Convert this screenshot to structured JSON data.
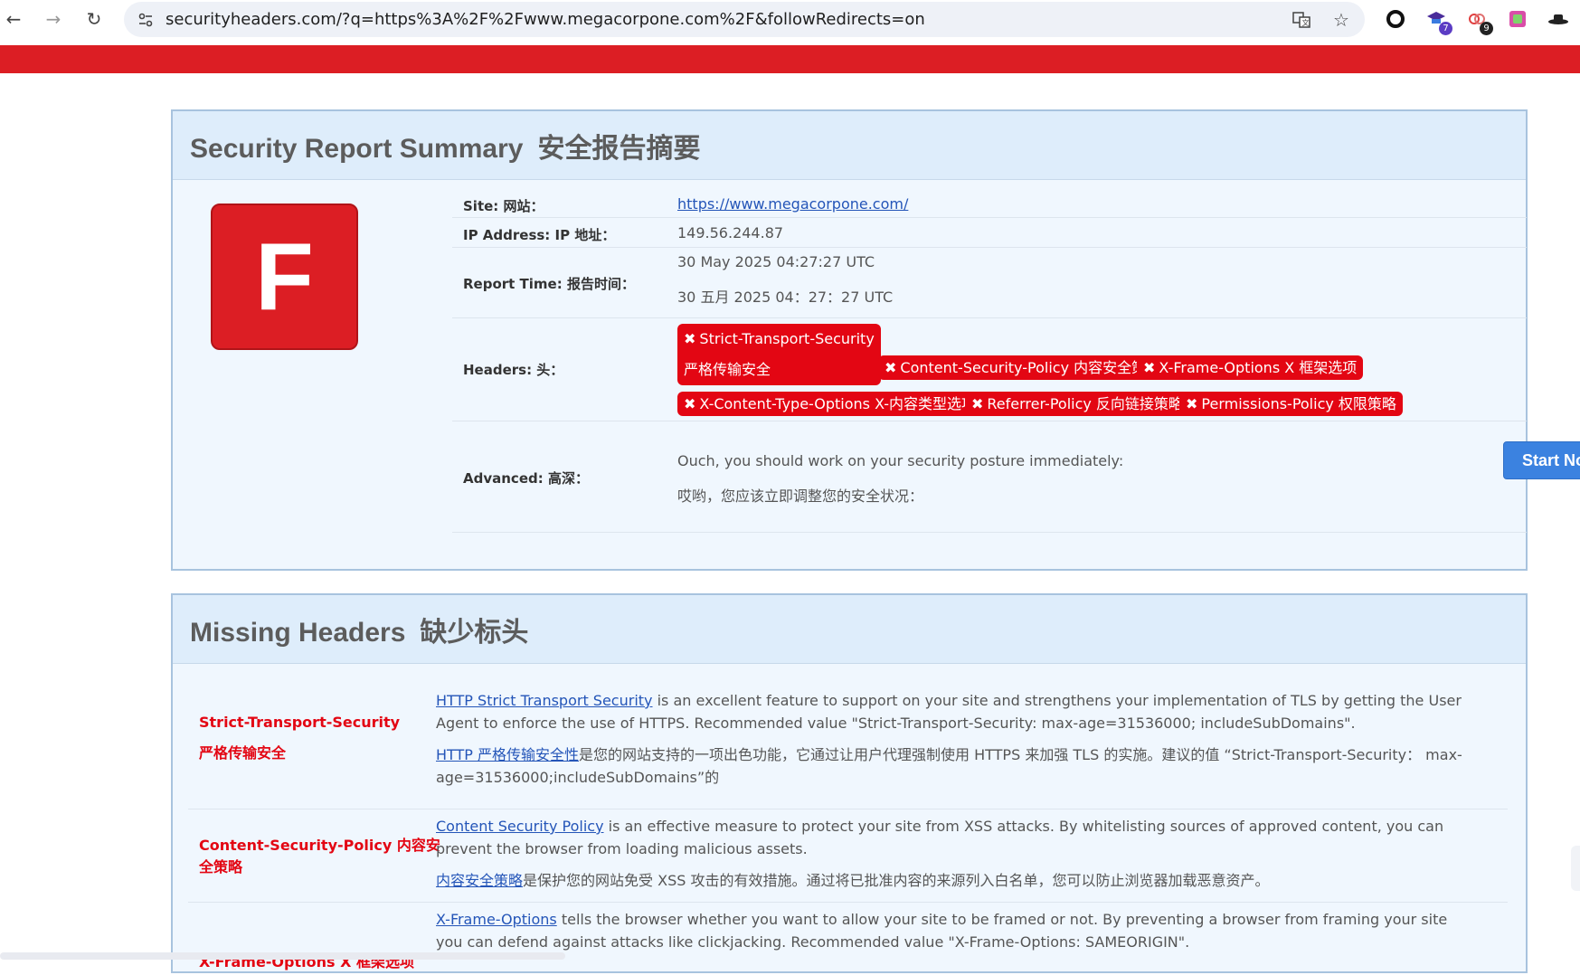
{
  "browser": {
    "url": "securityheaders.com/?q=https%3A%2F%2Fwww.megacorpone.com%2F&followRedirects=on",
    "ext_badges": [
      "7",
      "9"
    ]
  },
  "summary": {
    "title": "Security Report Summary",
    "title_zh": "安全报告摘要",
    "grade": "F",
    "site_label": "Site:  网站：",
    "site_value": "https://www.megacorpone.com/",
    "ip_label": "IP Address:  IP 地址：",
    "ip_value": "149.56.244.87",
    "time_label": "Report Time:  报告时间：",
    "time_value": "30 May 2025 04:27:27 UTC",
    "time_value_zh": "30 五月 2025 04：27：27 UTC",
    "headers_label": "Headers:  头：",
    "headers": [
      {
        "line1": "Strict-Transport-Security",
        "line2": "严格传输安全"
      },
      {
        "label": "Content-Security-Policy  内容安全策略"
      },
      {
        "label": "X-Frame-Options  X 框架选项"
      },
      {
        "label": "X-Content-Type-Options  X-内容类型选项"
      },
      {
        "label": "Referrer-Policy  反向链接策略"
      },
      {
        "label": "Permissions-Policy  权限策略"
      }
    ],
    "advanced_label": "Advanced:  高深：",
    "advanced_text": "Ouch, you should work on your security posture immediately:",
    "advanced_text_zh": "哎哟，您应该立即调整您的安全状况：",
    "start_button": "Start Now"
  },
  "missing": {
    "title": "Missing Headers",
    "title_zh": "缺少标头",
    "items": [
      {
        "name": "Strict-Transport-Security",
        "name_zh": "严格传输安全",
        "link": "HTTP Strict Transport Security",
        "text": " is an excellent feature to support on your site and strengthens your implementation of TLS by getting the User Agent to enforce the use of HTTPS. Recommended value \"Strict-Transport-Security: max-age=31536000; includeSubDomains\".",
        "link_zh": "HTTP 严格传输安全性",
        "text_zh": "是您的网站支持的一项出色功能，它通过让用户代理强制使用 HTTPS 来加强 TLS 的实施。建议的值 “Strict-Transport-Security： max-age=31536000;includeSubDomains”的"
      },
      {
        "name": "Content-Security-Policy  内容安全策略",
        "link": "Content Security Policy",
        "text": " is an effective measure to protect your site from XSS attacks. By whitelisting sources of approved content, you can prevent the browser from loading malicious assets.",
        "link_zh": "内容安全策略",
        "text_zh": "是保护您的网站免受 XSS 攻击的有效措施。通过将已批准内容的来源列入白名单，您可以防止浏览器加载恶意资产。"
      },
      {
        "name": "X-Frame-Options  X 框架选项",
        "link": "X-Frame-Options",
        "text": " tells the browser whether you want to allow your site to be framed or not. By preventing a browser from framing your site you can defend against attacks like clickjacking. Recommended value \"X-Frame-Options: SAMEORIGIN\"."
      }
    ]
  }
}
